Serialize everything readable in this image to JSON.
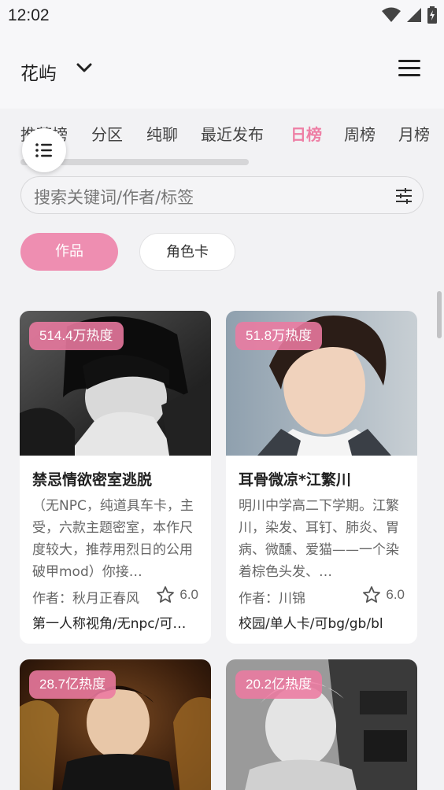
{
  "status_bar": {
    "time": "12:02",
    "icons": [
      "wifi-icon",
      "cellular-icon",
      "battery-charging-icon"
    ]
  },
  "header": {
    "title": "花屿",
    "dropdown_icon": "chevron-down-icon",
    "menu_icon": "hamburger-menu-icon"
  },
  "tabs": [
    {
      "label": "推荐榜",
      "active": false
    },
    {
      "label": "分区",
      "active": false
    },
    {
      "label": "纯聊",
      "active": false
    },
    {
      "label": "最近发布",
      "active": false
    },
    {
      "label": "日榜",
      "active": true
    },
    {
      "label": "周榜",
      "active": false
    },
    {
      "label": "月榜",
      "active": false
    }
  ],
  "search": {
    "placeholder": "搜索关键词/作者/标签",
    "filter_icon": "filter-sliders-icon"
  },
  "category_pills": [
    {
      "label": "作品",
      "selected": true
    },
    {
      "label": "角色卡",
      "selected": false
    }
  ],
  "colors": {
    "accent": "#ee7fa5",
    "pill_selected": "#ee8eb1",
    "badge": "#ec7aa0",
    "background": "#f2f2f4"
  },
  "cards": [
    {
      "heat": "514.4万热度",
      "title": "禁忌情欲密室逃脱",
      "description": "（无NPC，纯道具车卡，主受，六款主题密室，本作尺度较大，推荐用烈日的公用破甲mod）你接…",
      "author": "作者：秋月正春风",
      "rating": "6.0",
      "tags": "第一人称视角/无npc/可…"
    },
    {
      "heat": "51.8万热度",
      "title": "耳骨微凉*江繁川",
      "description": "明川中学高二下学期。江繁川，染发、耳钉、肺炎、胃病、微醺、爱猫——一个染着棕色头发、…",
      "author": "作者：川锦",
      "rating": "6.0",
      "tags": "校园/单人卡/可bg/gb/bl"
    },
    {
      "heat": "28.7亿热度"
    },
    {
      "heat": "20.2亿热度"
    }
  ]
}
